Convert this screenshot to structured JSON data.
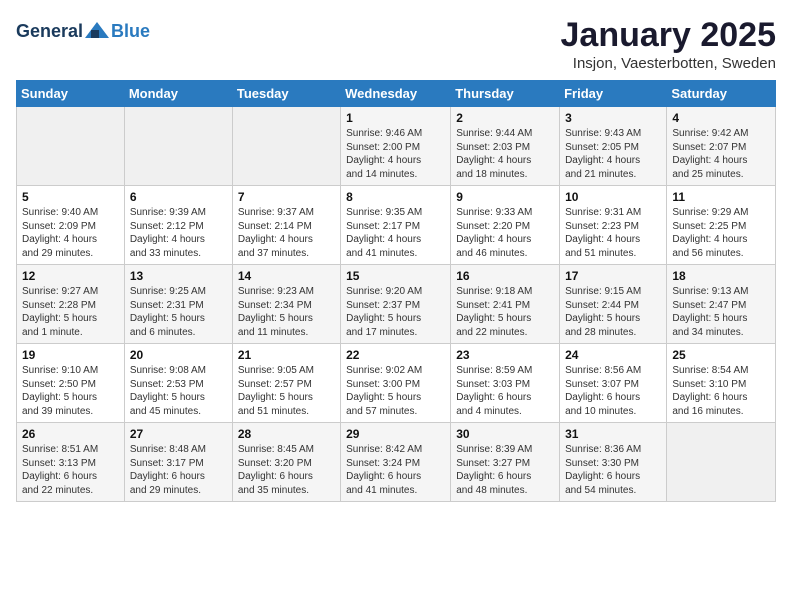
{
  "header": {
    "logo_general": "General",
    "logo_blue": "Blue",
    "title": "January 2025",
    "subtitle": "Insjon, Vaesterbotten, Sweden"
  },
  "days_of_week": [
    "Sunday",
    "Monday",
    "Tuesday",
    "Wednesday",
    "Thursday",
    "Friday",
    "Saturday"
  ],
  "weeks": [
    [
      {
        "day": "",
        "info": ""
      },
      {
        "day": "",
        "info": ""
      },
      {
        "day": "",
        "info": ""
      },
      {
        "day": "1",
        "info": "Sunrise: 9:46 AM\nSunset: 2:00 PM\nDaylight: 4 hours\nand 14 minutes."
      },
      {
        "day": "2",
        "info": "Sunrise: 9:44 AM\nSunset: 2:03 PM\nDaylight: 4 hours\nand 18 minutes."
      },
      {
        "day": "3",
        "info": "Sunrise: 9:43 AM\nSunset: 2:05 PM\nDaylight: 4 hours\nand 21 minutes."
      },
      {
        "day": "4",
        "info": "Sunrise: 9:42 AM\nSunset: 2:07 PM\nDaylight: 4 hours\nand 25 minutes."
      }
    ],
    [
      {
        "day": "5",
        "info": "Sunrise: 9:40 AM\nSunset: 2:09 PM\nDaylight: 4 hours\nand 29 minutes."
      },
      {
        "day": "6",
        "info": "Sunrise: 9:39 AM\nSunset: 2:12 PM\nDaylight: 4 hours\nand 33 minutes."
      },
      {
        "day": "7",
        "info": "Sunrise: 9:37 AM\nSunset: 2:14 PM\nDaylight: 4 hours\nand 37 minutes."
      },
      {
        "day": "8",
        "info": "Sunrise: 9:35 AM\nSunset: 2:17 PM\nDaylight: 4 hours\nand 41 minutes."
      },
      {
        "day": "9",
        "info": "Sunrise: 9:33 AM\nSunset: 2:20 PM\nDaylight: 4 hours\nand 46 minutes."
      },
      {
        "day": "10",
        "info": "Sunrise: 9:31 AM\nSunset: 2:23 PM\nDaylight: 4 hours\nand 51 minutes."
      },
      {
        "day": "11",
        "info": "Sunrise: 9:29 AM\nSunset: 2:25 PM\nDaylight: 4 hours\nand 56 minutes."
      }
    ],
    [
      {
        "day": "12",
        "info": "Sunrise: 9:27 AM\nSunset: 2:28 PM\nDaylight: 5 hours\nand 1 minute."
      },
      {
        "day": "13",
        "info": "Sunrise: 9:25 AM\nSunset: 2:31 PM\nDaylight: 5 hours\nand 6 minutes."
      },
      {
        "day": "14",
        "info": "Sunrise: 9:23 AM\nSunset: 2:34 PM\nDaylight: 5 hours\nand 11 minutes."
      },
      {
        "day": "15",
        "info": "Sunrise: 9:20 AM\nSunset: 2:37 PM\nDaylight: 5 hours\nand 17 minutes."
      },
      {
        "day": "16",
        "info": "Sunrise: 9:18 AM\nSunset: 2:41 PM\nDaylight: 5 hours\nand 22 minutes."
      },
      {
        "day": "17",
        "info": "Sunrise: 9:15 AM\nSunset: 2:44 PM\nDaylight: 5 hours\nand 28 minutes."
      },
      {
        "day": "18",
        "info": "Sunrise: 9:13 AM\nSunset: 2:47 PM\nDaylight: 5 hours\nand 34 minutes."
      }
    ],
    [
      {
        "day": "19",
        "info": "Sunrise: 9:10 AM\nSunset: 2:50 PM\nDaylight: 5 hours\nand 39 minutes."
      },
      {
        "day": "20",
        "info": "Sunrise: 9:08 AM\nSunset: 2:53 PM\nDaylight: 5 hours\nand 45 minutes."
      },
      {
        "day": "21",
        "info": "Sunrise: 9:05 AM\nSunset: 2:57 PM\nDaylight: 5 hours\nand 51 minutes."
      },
      {
        "day": "22",
        "info": "Sunrise: 9:02 AM\nSunset: 3:00 PM\nDaylight: 5 hours\nand 57 minutes."
      },
      {
        "day": "23",
        "info": "Sunrise: 8:59 AM\nSunset: 3:03 PM\nDaylight: 6 hours\nand 4 minutes."
      },
      {
        "day": "24",
        "info": "Sunrise: 8:56 AM\nSunset: 3:07 PM\nDaylight: 6 hours\nand 10 minutes."
      },
      {
        "day": "25",
        "info": "Sunrise: 8:54 AM\nSunset: 3:10 PM\nDaylight: 6 hours\nand 16 minutes."
      }
    ],
    [
      {
        "day": "26",
        "info": "Sunrise: 8:51 AM\nSunset: 3:13 PM\nDaylight: 6 hours\nand 22 minutes."
      },
      {
        "day": "27",
        "info": "Sunrise: 8:48 AM\nSunset: 3:17 PM\nDaylight: 6 hours\nand 29 minutes."
      },
      {
        "day": "28",
        "info": "Sunrise: 8:45 AM\nSunset: 3:20 PM\nDaylight: 6 hours\nand 35 minutes."
      },
      {
        "day": "29",
        "info": "Sunrise: 8:42 AM\nSunset: 3:24 PM\nDaylight: 6 hours\nand 41 minutes."
      },
      {
        "day": "30",
        "info": "Sunrise: 8:39 AM\nSunset: 3:27 PM\nDaylight: 6 hours\nand 48 minutes."
      },
      {
        "day": "31",
        "info": "Sunrise: 8:36 AM\nSunset: 3:30 PM\nDaylight: 6 hours\nand 54 minutes."
      },
      {
        "day": "",
        "info": ""
      }
    ]
  ]
}
